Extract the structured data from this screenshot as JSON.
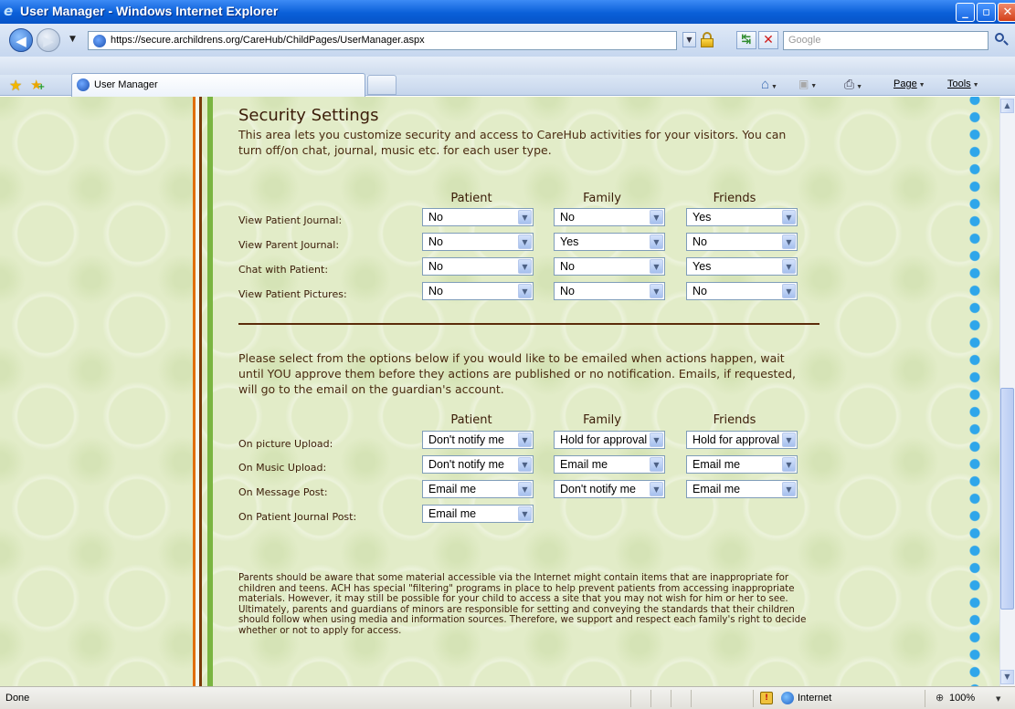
{
  "window": {
    "title": "User Manager - Windows Internet Explorer",
    "minimize": "_",
    "maximize": "▫",
    "close": "✕"
  },
  "address_bar": {
    "url": "https://secure.archildrens.org/CareHub/ChildPages/UserManager.aspx",
    "search_placeholder": "Google"
  },
  "tabs": {
    "active_label": "User Manager"
  },
  "command_bar": {
    "page_label": "Page",
    "tools_label": "Tools"
  },
  "page": {
    "section_title": "Security Settings",
    "intro": "This area lets you customize security and access to CareHub activities for your visitors. You can turn off/on chat, journal, music etc. for each user type.",
    "columns": [
      "Patient",
      "Family",
      "Friends"
    ],
    "access_rows": [
      {
        "label": "View Patient Journal:",
        "values": [
          "No",
          "No",
          "Yes"
        ]
      },
      {
        "label": "View Parent Journal:",
        "values": [
          "No",
          "Yes",
          "No"
        ]
      },
      {
        "label": "Chat with Patient:",
        "values": [
          "No",
          "No",
          "Yes"
        ]
      },
      {
        "label": "View Patient Pictures:",
        "values": [
          "No",
          "No",
          "No"
        ]
      }
    ],
    "notify_intro": "Please select from the options below if you would like to be emailed when actions happen, wait until YOU approve them before they actions are published or no notification. Emails, if requested, will go to the email on the guardian's account.",
    "notify_columns": [
      "Patient",
      "Family",
      "Friends"
    ],
    "notify_rows": [
      {
        "label": "On picture Upload:",
        "values": [
          "Don't notify me",
          "Hold for approval",
          "Hold for approval"
        ]
      },
      {
        "label": "On Music Upload:",
        "values": [
          "Don't notify me",
          "Email me",
          "Email me"
        ]
      },
      {
        "label": "On Message Post:",
        "values": [
          "Email me",
          "Don't notify me",
          "Email me"
        ]
      },
      {
        "label": "On Patient Journal Post:",
        "values": [
          "Email me"
        ]
      }
    ],
    "disclaimer": "Parents should be aware that some material accessible via the Internet might contain items that are inappropriate for children and teens. ACH has special \"filtering\" programs in place to help prevent patients from accessing inappropriate materials. However, it may still be possible for your child to access a site that you may not wish for him or her to see. Ultimately, parents and guardians of minors are responsible for setting and conveying the standards that their children should follow when using media and information sources. Therefore, we support and respect each family's right to decide whether or not to apply for access."
  },
  "status_bar": {
    "status": "Done",
    "zone": "Internet",
    "zoom": "100%"
  },
  "colors": {
    "titlebar": "#0a5fd8",
    "page_bg": "#e2ecc8",
    "text_brown": "#3b1c08",
    "accent_orange": "#e06e0c",
    "accent_green": "#7ab541",
    "dots_blue": "#2fa6ea"
  }
}
